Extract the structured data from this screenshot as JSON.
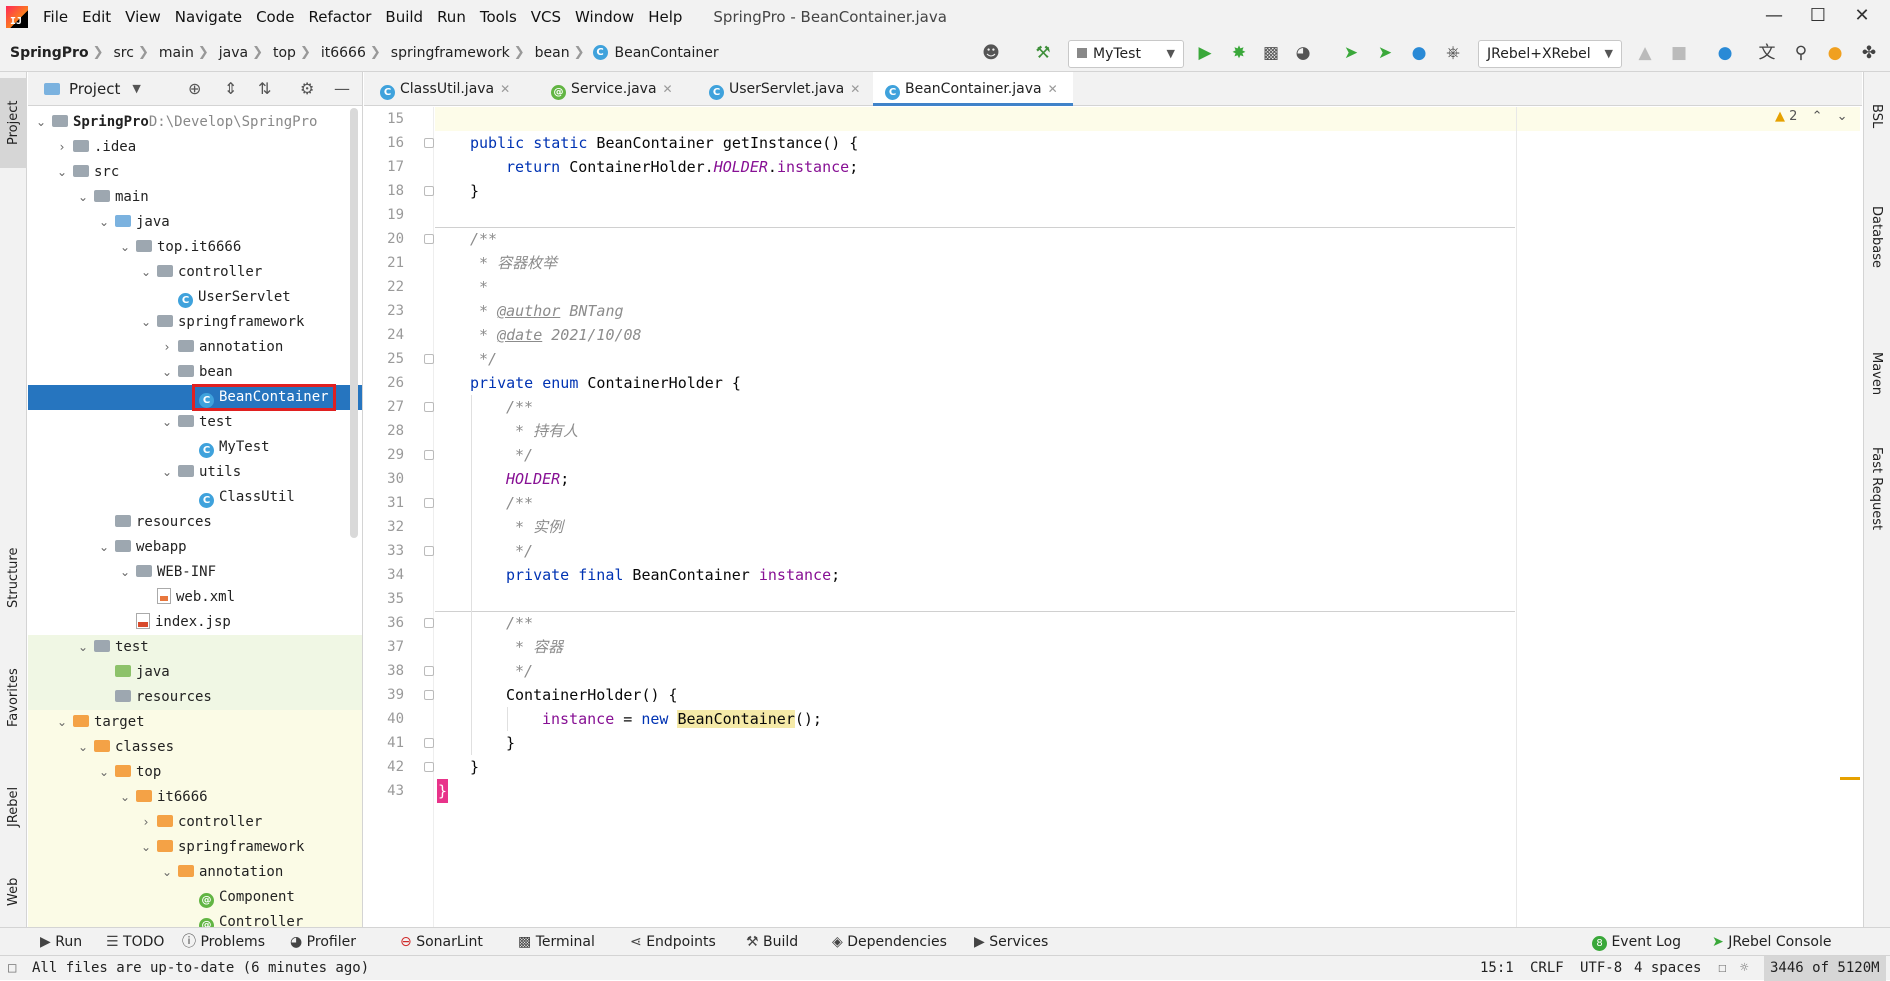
{
  "menu": {
    "items": [
      "File",
      "Edit",
      "View",
      "Navigate",
      "Code",
      "Refactor",
      "Build",
      "Run",
      "Tools",
      "VCS",
      "Window",
      "Help"
    ],
    "window_title": "SpringPro - BeanContainer.java"
  },
  "breadcrumbs": [
    "SpringPro",
    "src",
    "main",
    "java",
    "top",
    "it6666",
    "springframework",
    "bean",
    "BeanContainer"
  ],
  "toolbar": {
    "run_config": "MyTest",
    "jrebel_combo": "JRebel+XRebel"
  },
  "left_tabs": {
    "project": "Project",
    "structure": "Structure",
    "favorites": "Favorites",
    "jrebel": "JRebel",
    "web": "Web"
  },
  "right_tabs": {
    "bsl": "BSL",
    "database": "Database",
    "maven": "Maven",
    "fast_request": "Fast Request"
  },
  "project_panel": {
    "title": "Project",
    "tree": [
      {
        "label": "SpringPro",
        "extra": "D:\\Develop\\SpringPro",
        "depth": 0,
        "icon": "folder-gray",
        "expanded": true
      },
      {
        "label": ".idea",
        "depth": 1,
        "icon": "folder-gray",
        "expanded": false
      },
      {
        "label": "src",
        "depth": 1,
        "icon": "folder-gray",
        "expanded": true
      },
      {
        "label": "main",
        "depth": 2,
        "icon": "folder-gray",
        "expanded": true
      },
      {
        "label": "java",
        "depth": 3,
        "icon": "folder-blue",
        "expanded": true
      },
      {
        "label": "top.it6666",
        "depth": 4,
        "icon": "folder-gray",
        "expanded": true
      },
      {
        "label": "controller",
        "depth": 5,
        "icon": "folder-gray",
        "expanded": true
      },
      {
        "label": "UserServlet",
        "depth": 6,
        "icon": "class"
      },
      {
        "label": "springframework",
        "depth": 5,
        "icon": "folder-gray",
        "expanded": true
      },
      {
        "label": "annotation",
        "depth": 6,
        "icon": "folder-gray",
        "expanded": false
      },
      {
        "label": "bean",
        "depth": 6,
        "icon": "folder-gray",
        "expanded": true
      },
      {
        "label": "BeanContainer",
        "depth": 7,
        "icon": "class",
        "selected": true
      },
      {
        "label": "test",
        "depth": 6,
        "icon": "folder-gray",
        "expanded": true
      },
      {
        "label": "MyTest",
        "depth": 7,
        "icon": "class"
      },
      {
        "label": "utils",
        "depth": 6,
        "icon": "folder-gray",
        "expanded": true
      },
      {
        "label": "ClassUtil",
        "depth": 7,
        "icon": "class"
      },
      {
        "label": "resources",
        "depth": 3,
        "icon": "folder-gray"
      },
      {
        "label": "webapp",
        "depth": 3,
        "icon": "folder-gray",
        "expanded": true
      },
      {
        "label": "WEB-INF",
        "depth": 4,
        "icon": "folder-gray",
        "expanded": true
      },
      {
        "label": "web.xml",
        "depth": 5,
        "icon": "xml"
      },
      {
        "label": "index.jsp",
        "depth": 4,
        "icon": "jsp"
      },
      {
        "label": "test",
        "depth": 2,
        "icon": "folder-gray",
        "expanded": true,
        "bg": "green"
      },
      {
        "label": "java",
        "depth": 3,
        "icon": "folder-green",
        "bg": "green"
      },
      {
        "label": "resources",
        "depth": 3,
        "icon": "folder-gray",
        "bg": "green"
      },
      {
        "label": "target",
        "depth": 1,
        "icon": "folder-orange",
        "expanded": true,
        "bg": "yellow"
      },
      {
        "label": "classes",
        "depth": 2,
        "icon": "folder-orange",
        "expanded": true,
        "bg": "yellow"
      },
      {
        "label": "top",
        "depth": 3,
        "icon": "folder-orange",
        "expanded": true,
        "bg": "yellow"
      },
      {
        "label": "it6666",
        "depth": 4,
        "icon": "folder-orange",
        "expanded": true,
        "bg": "yellow"
      },
      {
        "label": "controller",
        "depth": 5,
        "icon": "folder-orange",
        "expanded": false,
        "bg": "yellow"
      },
      {
        "label": "springframework",
        "depth": 5,
        "icon": "folder-orange",
        "expanded": true,
        "bg": "yellow"
      },
      {
        "label": "annotation",
        "depth": 6,
        "icon": "folder-orange",
        "expanded": true,
        "bg": "yellow"
      },
      {
        "label": "Component",
        "depth": 7,
        "icon": "annotation",
        "bg": "yellow"
      },
      {
        "label": "Controller",
        "depth": 7,
        "icon": "annotation",
        "bg": "yellow"
      }
    ]
  },
  "editor_tabs": [
    {
      "label": "ClassUtil.java",
      "icon": "class"
    },
    {
      "label": "Service.java",
      "icon": "annotation"
    },
    {
      "label": "UserServlet.java",
      "icon": "class"
    },
    {
      "label": "BeanContainer.java",
      "icon": "class",
      "active": true
    }
  ],
  "editor": {
    "warning_count": "2",
    "lines": [
      {
        "n": "15"
      },
      {
        "n": "16"
      },
      {
        "n": "17"
      },
      {
        "n": "18"
      },
      {
        "n": "19"
      },
      {
        "n": "20"
      },
      {
        "n": "21"
      },
      {
        "n": "22"
      },
      {
        "n": "23"
      },
      {
        "n": "24"
      },
      {
        "n": "25"
      },
      {
        "n": "26"
      },
      {
        "n": "27"
      },
      {
        "n": "28"
      },
      {
        "n": "29"
      },
      {
        "n": "30"
      },
      {
        "n": "31"
      },
      {
        "n": "32"
      },
      {
        "n": "33"
      },
      {
        "n": "34"
      },
      {
        "n": "35"
      },
      {
        "n": "36"
      },
      {
        "n": "37"
      },
      {
        "n": "38"
      },
      {
        "n": "39"
      },
      {
        "n": "40"
      },
      {
        "n": "41"
      },
      {
        "n": "42"
      },
      {
        "n": "43"
      }
    ],
    "code": {
      "l16_kw": "public static",
      "l16_rest": " BeanContainer getInstance() {",
      "l17_kw": "return",
      "l17_a": " ContainerHolder.",
      "l17_holder": "HOLDER",
      "l17_b": ".",
      "l17_field": "instance",
      "l17_c": ";",
      "l18": "}",
      "l20": "/**",
      "l21": " * 容器枚举",
      "l22": " *",
      "l23_a": " * ",
      "l23_tag": "@author",
      "l23_b": " BNTang",
      "l24_a": " * ",
      "l24_tag": "@date",
      "l24_b": " 2021/10/08",
      "l25": " */",
      "l26_kw": "private enum",
      "l26_rest": " ContainerHolder {",
      "l27": "/**",
      "l28": " * 持有人",
      "l29": " */",
      "l30_holder": "HOLDER",
      "l30_rest": ";",
      "l31": "/**",
      "l32": " * 实例",
      "l33": " */",
      "l34_kw": "private final",
      "l34_a": " BeanContainer ",
      "l34_field": "instance",
      "l34_b": ";",
      "l36": "/**",
      "l37": " * 容器",
      "l38": " */",
      "l39": "ContainerHolder() {",
      "l40_field": "instance",
      "l40_a": " = ",
      "l40_kw": "new",
      "l40_b": " ",
      "l40_hl": "BeanContainer",
      "l40_c": "();",
      "l41": "}",
      "l42": "}",
      "l43": "}"
    }
  },
  "bottom_tools": [
    "Run",
    "TODO",
    "Problems",
    "Profiler",
    "SonarLint",
    "Terminal",
    "Endpoints",
    "Build",
    "Dependencies",
    "Services"
  ],
  "bottom_right_tools": [
    "Event Log",
    "JRebel Console"
  ],
  "event_log_count": "8",
  "status": {
    "message": "All files are up-to-date (6 minutes ago)",
    "position": "15:1",
    "line_sep": "CRLF",
    "encoding": "UTF-8",
    "indent": "4 spaces",
    "memory": "3446 of 5120M"
  },
  "colors": {
    "selection": "#2675bf",
    "keyword": "#0033b3",
    "static_field": "#871094",
    "comment": "#8c8c8c"
  }
}
